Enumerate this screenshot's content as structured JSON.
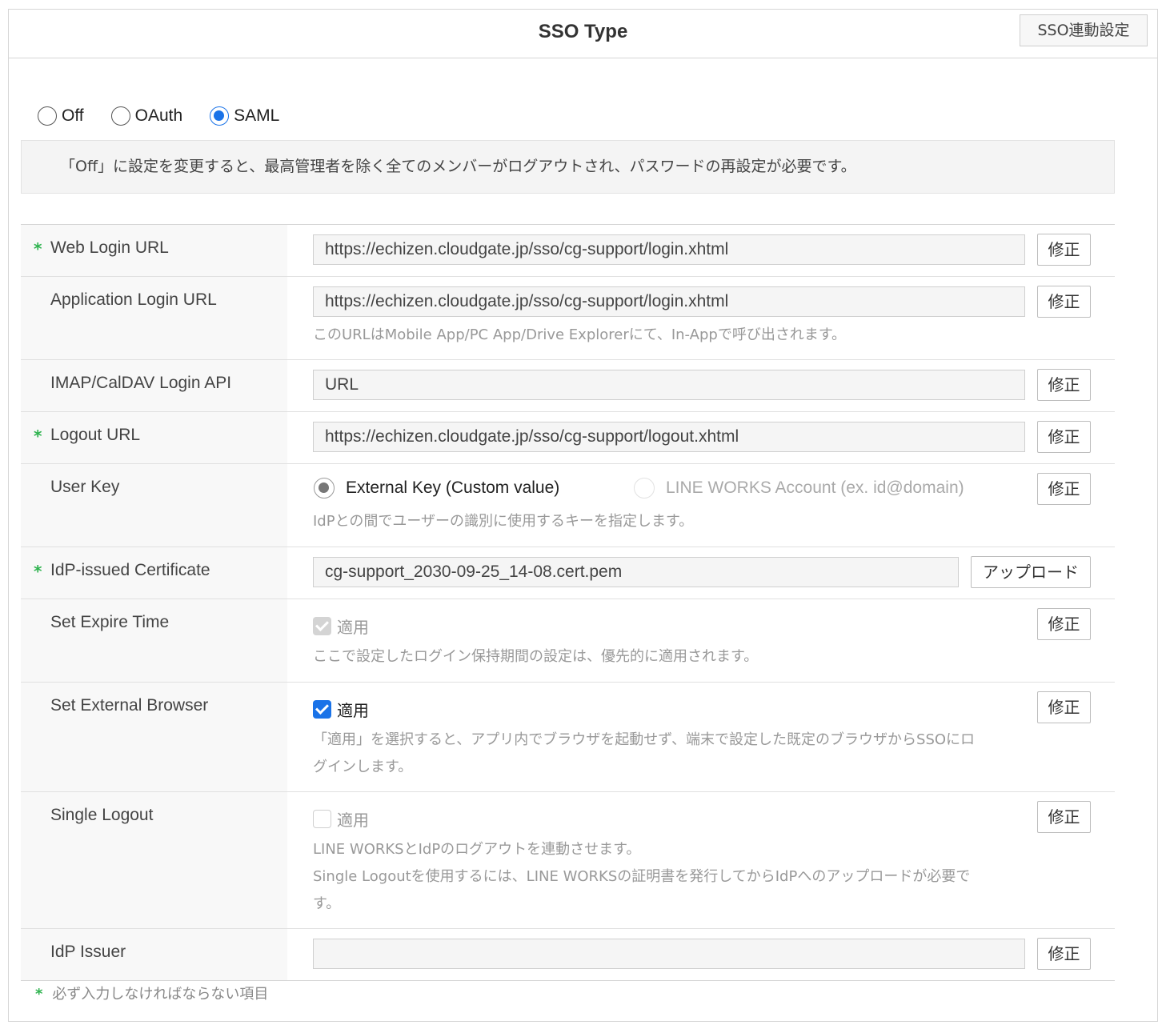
{
  "header": {
    "title": "SSO Type",
    "settings_button": "SSO連動設定"
  },
  "sso_type": {
    "options": [
      "Off",
      "OAuth",
      "SAML"
    ],
    "selected": "SAML"
  },
  "notice": "「Off」に設定を変更すると、最高管理者を除く全てのメンバーがログアウトされ、パスワードの再設定が必要です。",
  "form": {
    "edit_label": "修正",
    "upload_label": "アップロード",
    "web_login_url": {
      "label": "Web Login URL",
      "required": "*",
      "value": "https://echizen.cloudgate.jp/sso/cg-support/login.xhtml"
    },
    "application_login_url": {
      "label": "Application Login URL",
      "value": "https://echizen.cloudgate.jp/sso/cg-support/login.xhtml",
      "help": "このURLはMobile App/PC App/Drive Explorerにて、In-Appで呼び出されます。"
    },
    "imap_caldav_login_api": {
      "label": "IMAP/CalDAV Login API",
      "value": "URL"
    },
    "logout_url": {
      "label": "Logout URL",
      "required": "*",
      "value": "https://echizen.cloudgate.jp/sso/cg-support/logout.xhtml"
    },
    "user_key": {
      "label": "User Key",
      "option_external": "External Key (Custom value)",
      "option_lineworks": "LINE WORKS Account (ex. id@domain)",
      "selected": "External Key (Custom value)",
      "help": "IdPとの間でユーザーの識別に使用するキーを指定します。"
    },
    "idp_certificate": {
      "label": "IdP-issued Certificate",
      "required": "*",
      "value": "cg-support_2030-09-25_14-08.cert.pem"
    },
    "set_expire_time": {
      "label": "Set Expire Time",
      "check_label": "適用",
      "checked": true,
      "disabled": true,
      "help": "ここで設定したログイン保持期間の設定は、優先的に適用されます。"
    },
    "set_external_browser": {
      "label": "Set External Browser",
      "check_label": "適用",
      "checked": true,
      "help_line1": "「適用」を選択すると、アプリ内でブラウザを起動せず、端末で設定した既定のブラウザからSSOにロ",
      "help_line2": "グインします。"
    },
    "single_logout": {
      "label": "Single Logout",
      "check_label": "適用",
      "checked": false,
      "help_line1": "LINE WORKSとIdPのログアウトを連動させます。",
      "help_line2": "Single Logoutを使用するには、LINE WORKSの証明書を発行してからIdPへのアップロードが必要で",
      "help_line3": "す。"
    },
    "idp_issuer": {
      "label": "IdP Issuer",
      "value": ""
    }
  },
  "footnote": {
    "mark": "*",
    "text": "必ず入力しなければならない項目"
  },
  "colors": {
    "accent_blue": "#1a73e8",
    "required_green": "#2fb34f",
    "label_bg": "#f8f8f8"
  }
}
